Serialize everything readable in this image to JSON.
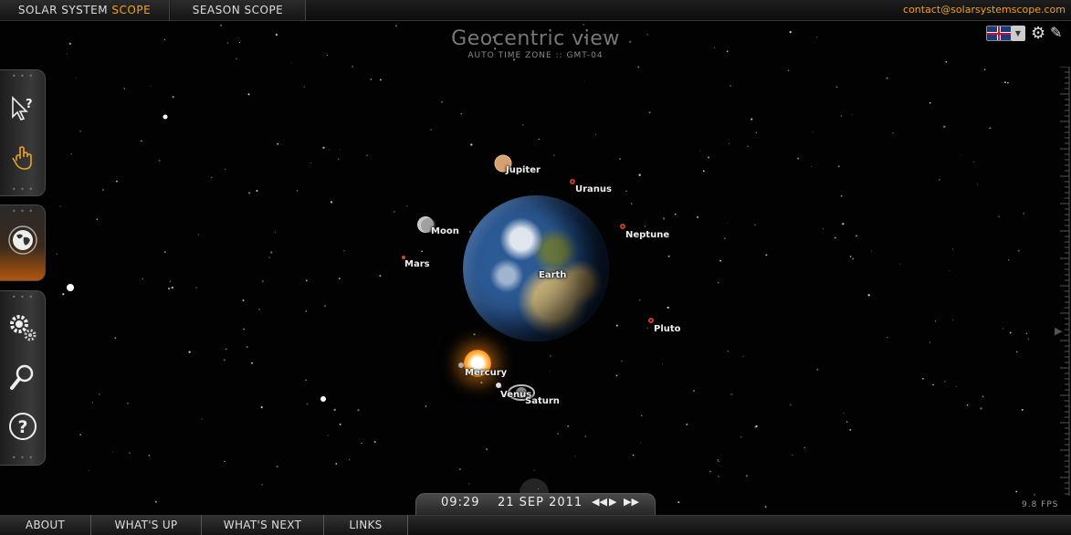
{
  "topbar": {
    "brand_main": "SOLAR SYSTEM",
    "brand_accent": "SCOPE",
    "season_tab": "SEASON SCOPE",
    "contact": "contact@solarsystemscope.com"
  },
  "header": {
    "title": "Geocentric view",
    "subtitle": "AUTO TIME ZONE :: GMT-04"
  },
  "icons": {
    "language_flag": "uk-flag-icon",
    "settings": "gear-icon",
    "edit": "edit-icon"
  },
  "sidebar": {
    "items": [
      {
        "icon": "pointer-help-icon"
      },
      {
        "icon": "hand-pointer-icon",
        "active": true
      },
      {
        "icon": "globe-view-icon",
        "active": true
      },
      {
        "icon": "settings-gears-icon"
      },
      {
        "icon": "magnifier-icon"
      },
      {
        "icon": "help-icon"
      }
    ]
  },
  "bodies": {
    "jupiter": "Jupiter",
    "uranus": "Uranus",
    "moon": "Moon",
    "neptune": "Neptune",
    "mars": "Mars",
    "earth": "Earth",
    "pluto": "Pluto",
    "mercury": "Mercury",
    "venus": "Venus",
    "saturn": "Saturn"
  },
  "timebar": {
    "clock": "09:29",
    "date": "21 SEP 2011",
    "controls": [
      "rewind",
      "play",
      "fast-forward"
    ]
  },
  "fps": "9.8 FPS",
  "bottom_nav": [
    "ABOUT",
    "WHAT'S UP",
    "WHAT'S NEXT",
    "LINKS"
  ],
  "colors": {
    "accent": "#f0a020",
    "orbit_marker": "#c0422a",
    "background": "#020203"
  }
}
